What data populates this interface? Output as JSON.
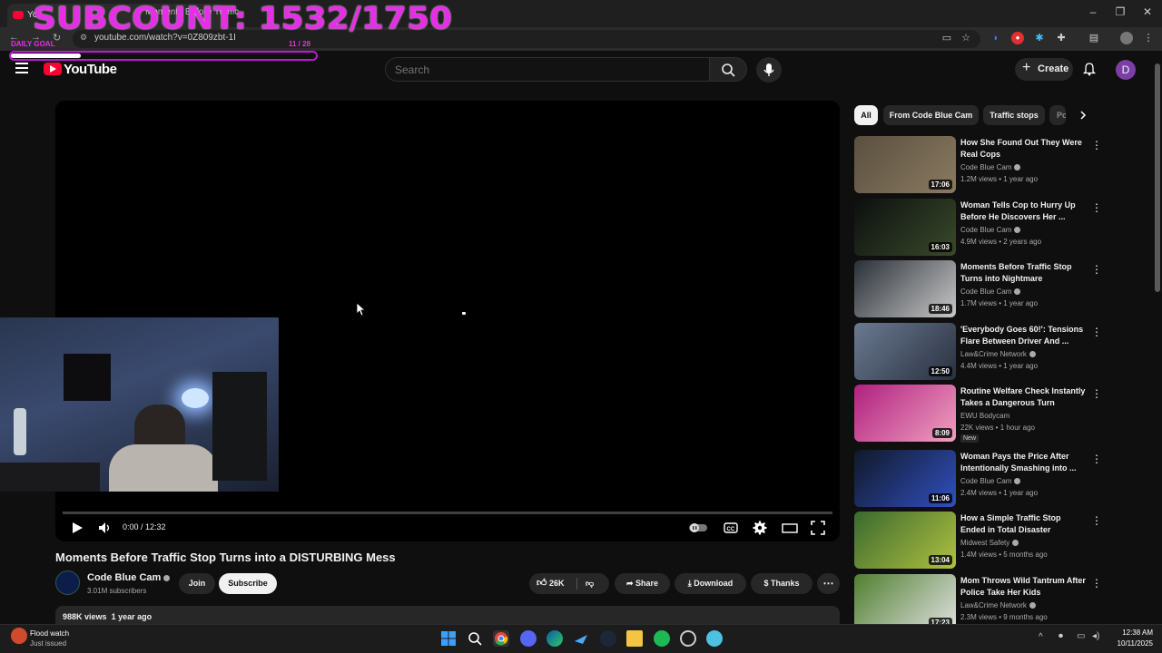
{
  "browser": {
    "tab_title": "Yo",
    "tab_title_2": "Moments Before Traffic",
    "url": "youtube.com/watch?v=0Z809zbt-1I"
  },
  "overlay": {
    "subcount": "SUBCOUNT: 1532/1750",
    "goal_left": "DAILY GOAL",
    "goal_right": "11 / 28",
    "progress_fraction": 0.23
  },
  "header": {
    "logo_text": "YouTube",
    "search_placeholder": "Search",
    "create_label": "Create",
    "avatar_letter": "D"
  },
  "player": {
    "time": "0:00 / 12:32"
  },
  "video": {
    "title": "Moments Before Traffic Stop Turns into a DISTURBING Mess",
    "channel": "Code Blue Cam",
    "subscribers": "3.01M subscribers",
    "join_label": "Join",
    "subscribe_label": "Subscribe",
    "likes": "26K",
    "share_label": "Share",
    "download_label": "Download",
    "thanks_label": "Thanks",
    "views": "988K views",
    "age": "1 year ago"
  },
  "chips": [
    "All",
    "From Code Blue Cam",
    "Traffic stops",
    "Po"
  ],
  "recommendations": [
    {
      "title": "How She Found Out They Were Real Cops",
      "channel": "Code Blue Cam",
      "verified": true,
      "meta": "1.2M views • 1 year ago",
      "duration": "17:06",
      "colors": [
        "#5a5040",
        "#8a7a60"
      ]
    },
    {
      "title": "Woman Tells Cop to Hurry Up Before He Discovers Her ...",
      "channel": "Code Blue Cam",
      "verified": true,
      "meta": "4.9M views • 2 years ago",
      "duration": "16:03",
      "colors": [
        "#0c0f10",
        "#3a4a2a"
      ]
    },
    {
      "title": "Moments Before Traffic Stop Turns into Nightmare",
      "channel": "Code Blue Cam",
      "verified": true,
      "meta": "1.7M views • 1 year ago",
      "duration": "18:46",
      "colors": [
        "#2a3038",
        "#c8c8c8"
      ]
    },
    {
      "title": "'Everybody Goes 60!': Tensions Flare Between Driver And ...",
      "channel": "Law&Crime Network",
      "verified": true,
      "meta": "4.4M views • 1 year ago",
      "duration": "12:50",
      "colors": [
        "#6a7a90",
        "#2a3040"
      ]
    },
    {
      "title": "Routine Welfare Check Instantly Takes a Dangerous Turn",
      "channel": "EWU Bodycam",
      "verified": false,
      "meta": "22K views • 1 hour ago",
      "badge": "New",
      "duration": "8:09",
      "colors": [
        "#b02080",
        "#f0a0c0"
      ]
    },
    {
      "title": "Woman Pays the Price After Intentionally Smashing into ...",
      "channel": "Code Blue Cam",
      "verified": true,
      "meta": "2.4M views • 1 year ago",
      "duration": "11:06",
      "colors": [
        "#101828",
        "#3050c0"
      ]
    },
    {
      "title": "How a Simple Traffic Stop Ended in Total Disaster",
      "channel": "Midwest Safety",
      "verified": true,
      "meta": "1.4M views • 5 months ago",
      "duration": "13:04",
      "colors": [
        "#3a6a30",
        "#b0c040"
      ]
    },
    {
      "title": "Mom Throws Wild Tantrum After Police Take Her Kids",
      "channel": "Law&Crime Network",
      "verified": true,
      "meta": "2.3M views • 9 months ago",
      "duration": "17:23",
      "colors": [
        "#508030",
        "#e0e0e0"
      ]
    }
  ],
  "taskbar": {
    "weather_title": "Flood watch",
    "weather_sub": "Just issued",
    "time": "12:38 AM",
    "date": "10/11/2025"
  }
}
